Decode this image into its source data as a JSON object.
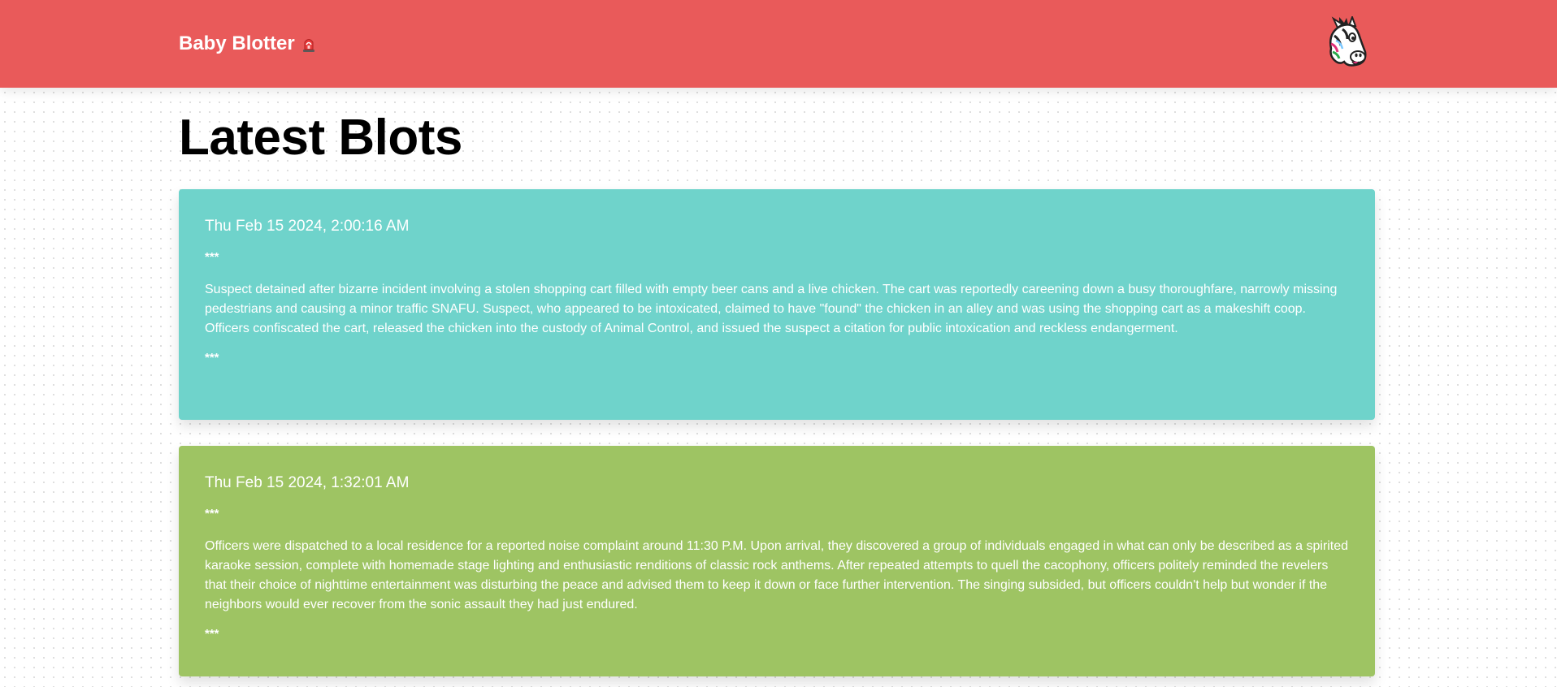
{
  "header": {
    "brand_label": "Baby Blotter",
    "brand_icon": "siren-icon",
    "avatar_icon": "zebra-avatar-icon",
    "background_color": "#e95a5a"
  },
  "main": {
    "title": "Latest Blots"
  },
  "blots": [
    {
      "date": "Thu Feb 15 2024, 2:00:16 AM",
      "separator_top": "***",
      "body": "Suspect detained after bizarre incident involving a stolen shopping cart filled with empty beer cans and a live chicken. The cart was reportedly careening down a busy thoroughfare, narrowly missing pedestrians and causing a minor traffic SNAFU. Suspect, who appeared to be intoxicated, claimed to have \"found\" the chicken in an alley and was using the shopping cart as a makeshift coop. Officers confiscated the cart, released the chicken into the custody of Animal Control, and issued the suspect a citation for public intoxication and reckless endangerment.",
      "separator_bottom": "***",
      "color": "#6fd3cb"
    },
    {
      "date": "Thu Feb 15 2024, 1:32:01 AM",
      "separator_top": "***",
      "body": "Officers were dispatched to a local residence for a reported noise complaint around 11:30 P.M. Upon arrival, they discovered a group of individuals engaged in what can only be described as a spirited karaoke session, complete with homemade stage lighting and enthusiastic renditions of classic rock anthems. After repeated attempts to quell the cacophony, officers politely reminded the revelers that their choice of nighttime entertainment was disturbing the peace and advised them to keep it down or face further intervention. The singing subsided, but officers couldn't help but wonder if the neighbors would ever recover from the sonic assault they had just endured.",
      "separator_bottom": "***",
      "color": "#9ec463"
    }
  ]
}
